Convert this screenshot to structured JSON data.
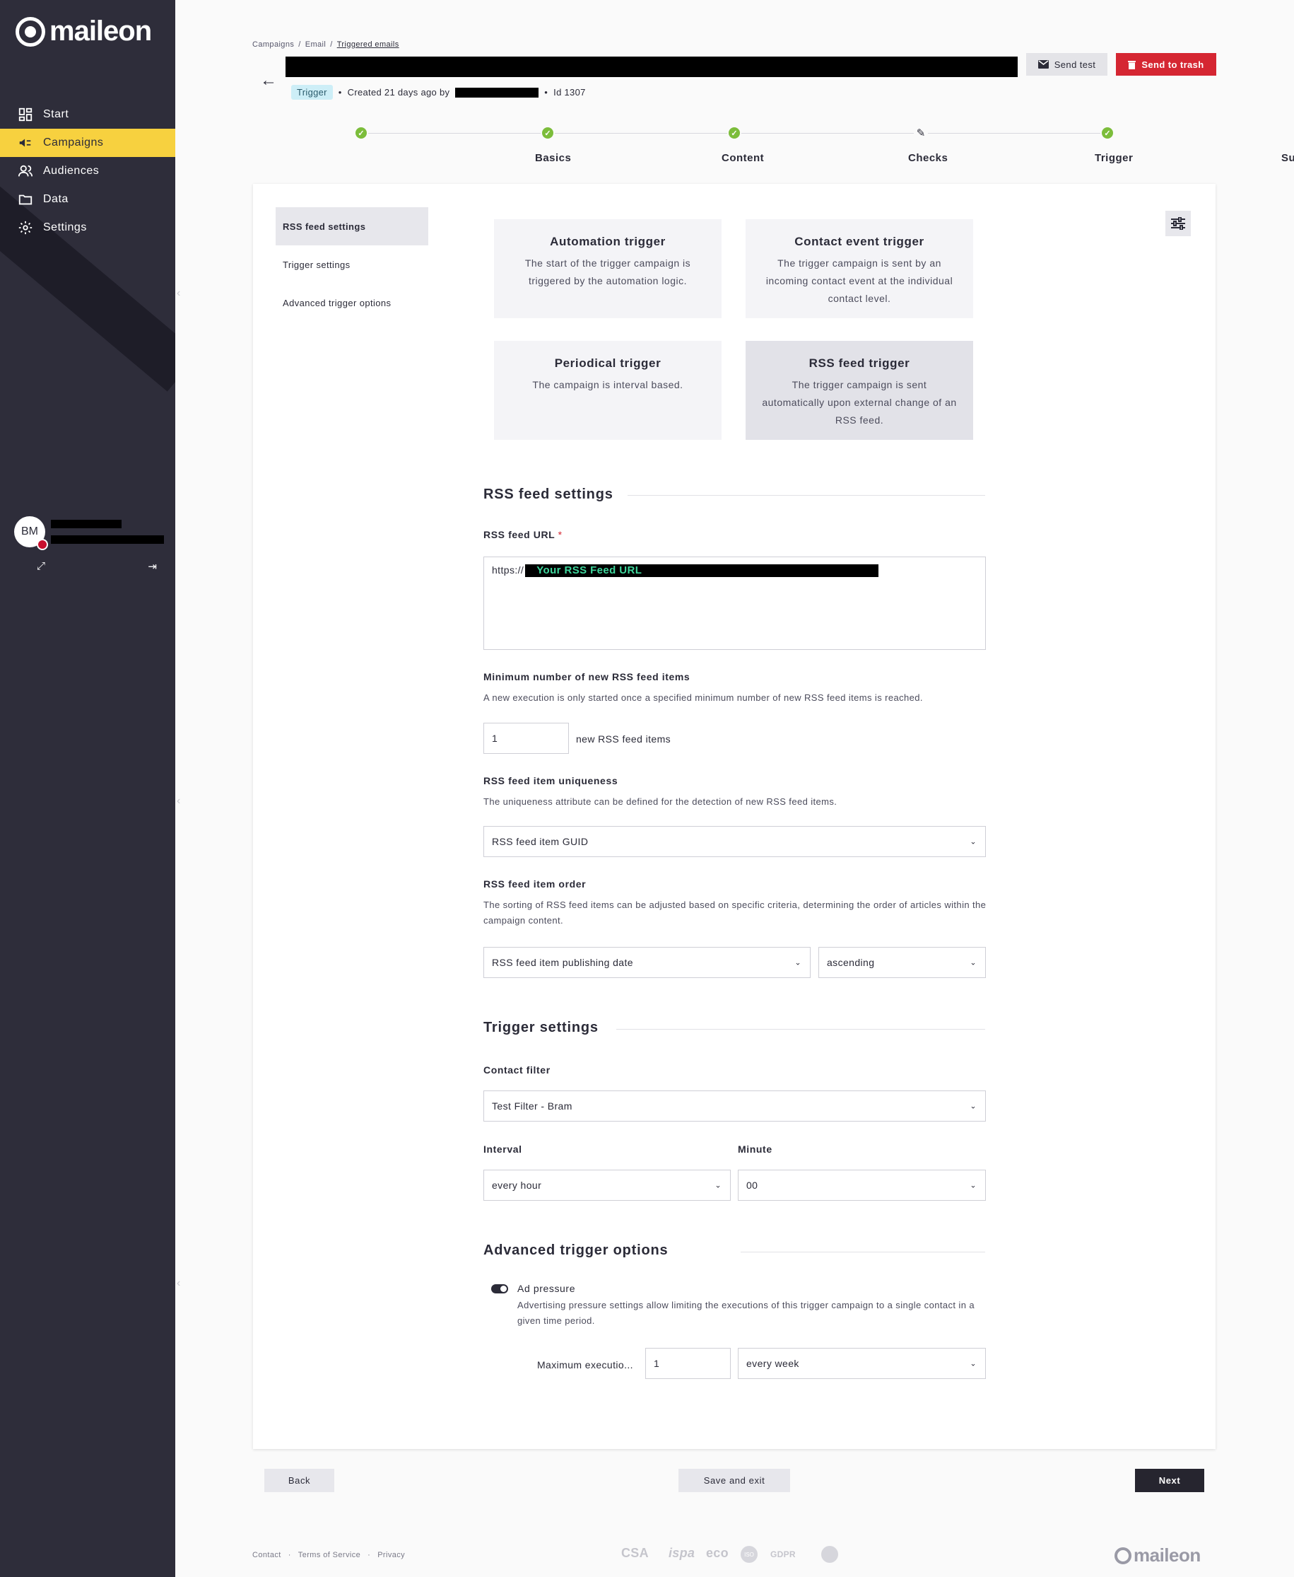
{
  "brand": {
    "name": "maileon",
    "accent": "#f7d13f",
    "danger": "#d52632",
    "success": "#7cbd3b",
    "sidebar_bg": "#2e2d3a"
  },
  "sidebar": {
    "items": [
      {
        "label": "Start",
        "icon": "dashboard-icon"
      },
      {
        "label": "Campaigns",
        "icon": "megaphone-icon",
        "active": true
      },
      {
        "label": "Audiences",
        "icon": "people-icon"
      },
      {
        "label": "Data",
        "icon": "folder-icon"
      },
      {
        "label": "Settings",
        "icon": "gear-icon"
      }
    ],
    "user": {
      "initials": "BM"
    }
  },
  "breadcrumb": [
    "Campaigns",
    "Email",
    "Triggered emails"
  ],
  "header": {
    "send_test_label": "Send test",
    "send_trash_label": "Send to trash",
    "tag": "Trigger",
    "created_text": "Created 21 days ago by",
    "id_text": "Id 1307"
  },
  "stepper": [
    {
      "label": "Basics",
      "state": "done"
    },
    {
      "label": "Content",
      "state": "done"
    },
    {
      "label": "Checks",
      "state": "done"
    },
    {
      "label": "Trigger",
      "state": "editing"
    },
    {
      "label": "Summary",
      "state": "done"
    }
  ],
  "subnav": [
    "RSS feed settings",
    "Trigger settings",
    "Advanced trigger options"
  ],
  "trigger_types": [
    {
      "title": "Automation trigger",
      "desc": "The start of the trigger campaign is triggered by the automation logic."
    },
    {
      "title": "Contact event trigger",
      "desc": "The trigger campaign is sent by an incoming contact event at the individual contact level."
    },
    {
      "title": "Periodical trigger",
      "desc": "The campaign is interval based."
    },
    {
      "title": "RSS feed trigger",
      "desc": "The trigger campaign is sent automatically upon external change of an RSS feed.",
      "selected": true
    }
  ],
  "rss": {
    "section_title": "RSS feed settings",
    "url_label": "RSS feed URL",
    "url_required_mark": "*",
    "url_prefix": "https://",
    "url_overlay": "Your RSS Feed URL",
    "min_items_label": "Minimum number of new RSS feed items",
    "min_items_hint": "A new execution is only started once a specified minimum number of new RSS feed items is reached.",
    "min_items_value": "1",
    "min_items_suffix": "new RSS feed items",
    "uniqueness_label": "RSS feed item uniqueness",
    "uniqueness_hint": "The uniqueness attribute can be defined for the detection of new RSS feed items.",
    "uniqueness_value": "RSS feed item GUID",
    "order_label": "RSS feed item order",
    "order_hint": "The sorting of RSS feed items can be adjusted based on specific criteria, determining the order of articles within the campaign content.",
    "order_field_value": "RSS feed item publishing date",
    "order_direction_value": "ascending"
  },
  "trigger_settings": {
    "section_title": "Trigger settings",
    "contact_filter_label": "Contact filter",
    "contact_filter_value": "Test Filter - Bram",
    "interval_label": "Interval",
    "interval_value": "every hour",
    "minute_label": "Minute",
    "minute_value": "00"
  },
  "advanced": {
    "section_title": "Advanced trigger options",
    "ad_pressure_label": "Ad pressure",
    "ad_pressure_enabled": true,
    "ad_pressure_hint": "Advertising pressure settings allow limiting the executions of this trigger campaign to a single contact in a given time period.",
    "max_exec_label": "Maximum executio...",
    "max_exec_value": "1",
    "period_value": "every week"
  },
  "footer_buttons": {
    "back": "Back",
    "save_exit": "Save and exit",
    "next": "Next"
  },
  "footer_links": [
    "Contact",
    "Terms of Service",
    "Privacy"
  ],
  "certifications": [
    "CSA",
    "ispa",
    "eco",
    "ISO",
    "GDPR"
  ]
}
